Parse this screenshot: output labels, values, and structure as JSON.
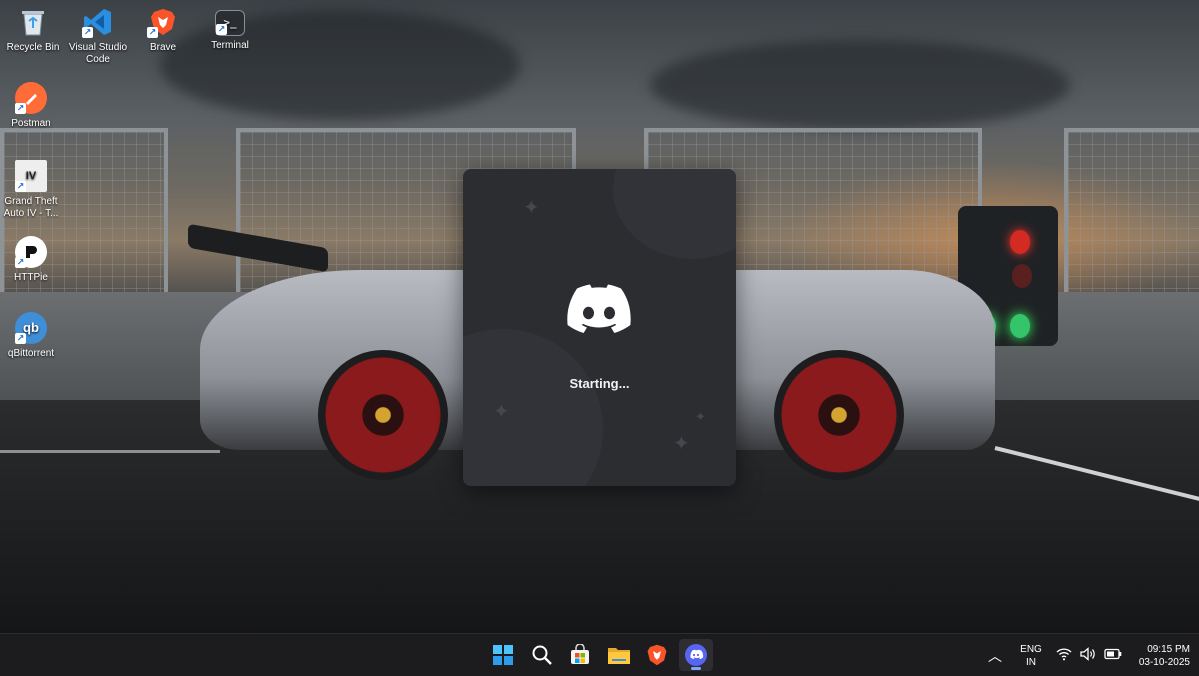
{
  "desktop": {
    "icons": [
      {
        "label": "Recycle Bin",
        "icon": "recycle-bin-icon"
      },
      {
        "label": "Visual Studio Code",
        "icon": "vscode-icon"
      },
      {
        "label": "Brave",
        "icon": "brave-icon"
      },
      {
        "label": "Terminal",
        "icon": "terminal-icon"
      },
      {
        "label": "Postman",
        "icon": "postman-icon"
      },
      {
        "label": "Grand Theft Auto IV - T...",
        "icon": "gta-iv-icon"
      },
      {
        "label": "HTTPie",
        "icon": "httpie-icon"
      },
      {
        "label": "qBittorrent",
        "icon": "qbittorrent-icon"
      }
    ]
  },
  "splash": {
    "app": "Discord",
    "status": "Starting...",
    "background": "#2b2d31",
    "logo_icon": "discord-logo-icon"
  },
  "taskbar": {
    "pinned": [
      {
        "name": "Start",
        "icon": "windows-start-icon"
      },
      {
        "name": "Search",
        "icon": "search-icon"
      },
      {
        "name": "Microsoft Store",
        "icon": "store-icon"
      },
      {
        "name": "File Explorer",
        "icon": "folder-icon"
      },
      {
        "name": "Brave",
        "icon": "brave-icon"
      },
      {
        "name": "Discord",
        "icon": "discord-icon",
        "active": true
      }
    ],
    "tray": {
      "language_line1": "ENG",
      "language_line2": "IN",
      "time": "09:15 PM",
      "date": "03-10-2025"
    }
  },
  "colors": {
    "discord_blurple": "#5865f2",
    "taskbar_bg": "#1c1c1e",
    "brave_orange": "#fb542b"
  }
}
